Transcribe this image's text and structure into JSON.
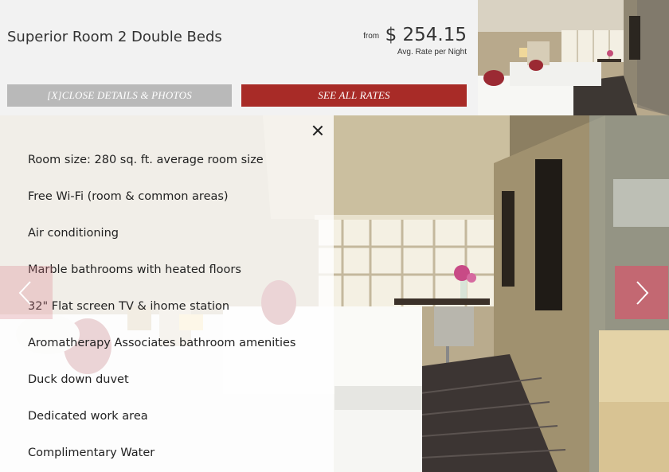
{
  "room": {
    "title": "Superior Room 2 Double Beds",
    "price_prefix": "from",
    "price": "$ 254.15",
    "price_note": "Avg. Rate per Night"
  },
  "buttons": {
    "close_details": "[X]CLOSE DETAILS & PHOTOS",
    "see_all_rates": "SEE ALL RATES"
  },
  "amenities": [
    "Room size: 280 sq. ft. average room size",
    "Free Wi-Fi (room & common areas)",
    "Air conditioning",
    "Marble bathrooms with heated floors",
    "32\" Flat screen TV & ihome station",
    "Aromatherapy Associates bathroom amenities",
    "Duck down duvet",
    "Dedicated work area",
    "Complimentary Water"
  ],
  "colors": {
    "accent": "#a82b27",
    "close_button": "#b9b9b9",
    "header_bg": "#f2f2f2",
    "arrow": "#ce5c6e"
  },
  "icons": {
    "close": "close-icon",
    "prev": "chevron-left-icon",
    "next": "chevron-right-icon"
  }
}
